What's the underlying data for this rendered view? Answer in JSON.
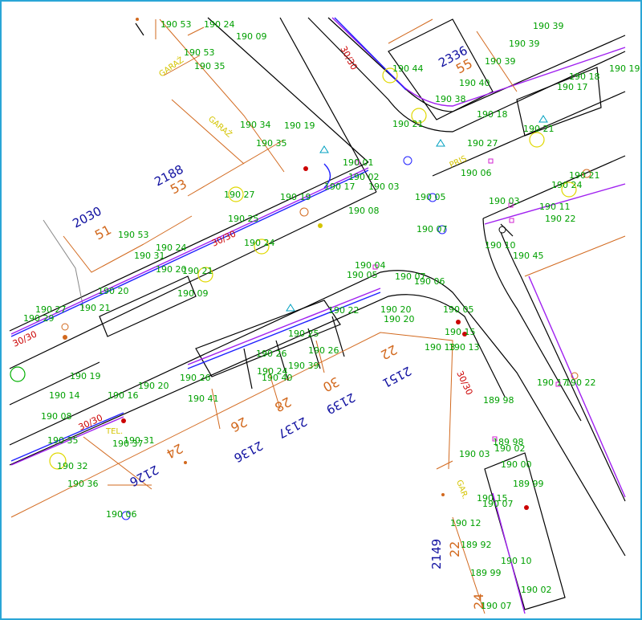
{
  "colors": {
    "frame": "#2aa6d6",
    "road_edge": "#000000",
    "cable_purple": "#a020f0",
    "cable_blue": "#2020ff",
    "parcel_orange": "#d2691e",
    "elevation_green": "#00a000",
    "parcel_number_blue": "#1010a0",
    "text_yellow": "#d4c400",
    "speed_red": "#cc0000",
    "tree_yellow": "#e0d800",
    "tree_green": "#00b000",
    "manhole_cyan": "#00a0c0"
  },
  "parcel_numbers": [
    "2336",
    "2188",
    "2030",
    "2126",
    "2136",
    "2137",
    "2139",
    "2151",
    "2149"
  ],
  "house_numbers": [
    "55",
    "53",
    "51",
    "24",
    "26",
    "28",
    "30",
    "22",
    "22",
    "24"
  ],
  "speed_labels": [
    "30/30",
    "30/30",
    "30/30",
    "30/30",
    "30/30"
  ],
  "annotations": [
    "GARAŻ",
    "GARAŻ",
    "PRIS",
    "TEL.",
    "GAR."
  ],
  "elevations": [
    "190 53",
    "190 24",
    "190 09",
    "190 53",
    "190 35",
    "190 34",
    "190 35",
    "190 19",
    "190 01",
    "190 17",
    "190 02",
    "190 03",
    "190 05",
    "190 07",
    "190 08",
    "190 27",
    "190 25",
    "190 19",
    "190 24",
    "190 53",
    "190 24",
    "190 20",
    "190 21",
    "190 31",
    "190 09",
    "190 20",
    "190 21",
    "190 27",
    "190 29",
    "190 39",
    "190 39",
    "190 39",
    "190 44",
    "190 40",
    "190 38",
    "190 21",
    "190 18",
    "190 21",
    "190 27",
    "190 06",
    "190 03",
    "190 11",
    "190 22",
    "190 10",
    "190 45",
    "190 21",
    "190 24",
    "190 17",
    "190 18",
    "190 19",
    "190 04",
    "190 05",
    "190 07",
    "190 06",
    "190 20",
    "190 20",
    "190 05",
    "190 15",
    "190 13",
    "190 13",
    "190 22",
    "190 25",
    "190 26",
    "190 26",
    "190 39",
    "190 40",
    "190 24",
    "190 41",
    "190 26",
    "190 19",
    "190 20",
    "190 14",
    "190 16",
    "190 08",
    "190 35",
    "190 37",
    "190 31",
    "190 32",
    "190 36",
    "190 06",
    "189 98",
    "189 98",
    "190 02",
    "190 03",
    "190 00",
    "189 99",
    "190 07",
    "190 12",
    "189 92",
    "190 10",
    "189 99",
    "190 02",
    "190 07",
    "190 15",
    "190 17",
    "190 22"
  ]
}
